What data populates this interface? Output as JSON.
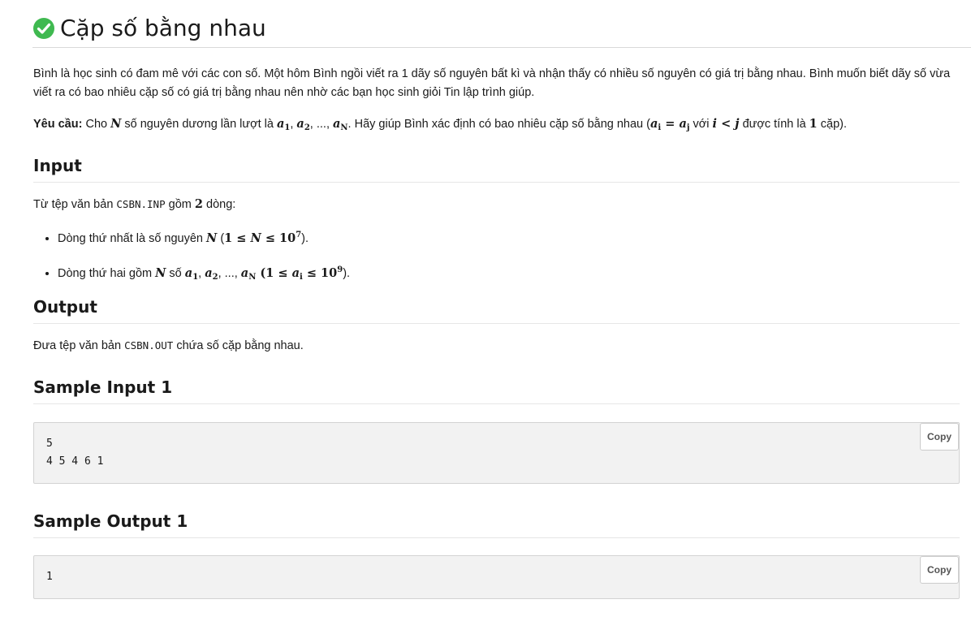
{
  "title": "Cặp số bằng nhau",
  "statement": {
    "p1": "Bình là học sinh có đam mê với các con số. Một hôm Bình ngồi viết ra 1 dãy số nguyên bất kì và nhận thấy có nhiều số nguyên có giá trị bằng nhau. Bình muốn biết dãy số vừa viết ra có bao nhiêu cặp số có giá trị bằng nhau nên nhờ các bạn học sinh giỏi Tin lập trình giúp.",
    "req_label": "Yêu cầu:",
    "req_t1": " Cho ",
    "req_t2": " số nguyên dương lần lượt là ",
    "req_t3": ". Hãy giúp Bình xác định có bao nhiêu cặp số bằng nhau (",
    "req_t4": " với ",
    "req_t5": " được tính là ",
    "req_t6": " cặp).",
    "N": "N",
    "a": "a",
    "sub1": "1",
    "sub2": "2",
    "subN": "N",
    "subi": "i",
    "subj": "j",
    "comma": ", ",
    "ellipsis": ", ..., ",
    "eq": " = ",
    "lt": " < ",
    "i": "i",
    "j": "j",
    "one": "1"
  },
  "input": {
    "heading": "Input",
    "desc_t1": "Từ tệp văn bản ",
    "file": "CSBN.INP",
    "desc_t2": " gồm ",
    "two": "2",
    "desc_t3": " dòng:",
    "li1_t1": "Dòng thứ nhất là số nguyên ",
    "li1_paren_open": " (",
    "li1_math1": "1 ≤ ",
    "li1_math2": " ≤ 10",
    "li1_exp": "7",
    "li1_close": ").",
    "li2_t1": "Dòng thứ hai gồm ",
    "li2_t2": " số ",
    "li2_math1": " (1 ≤ ",
    "li2_math2": " ≤ 10",
    "li2_exp": "9",
    "li2_close": ")."
  },
  "output": {
    "heading": "Output",
    "desc_t1": "Đưa tệp văn bản ",
    "file": "CSBN.OUT",
    "desc_t2": " chứa số cặp bằng nhau."
  },
  "sample_input": {
    "heading": "Sample Input 1",
    "code": "5\n4 5 4 6 1",
    "copy": "Copy"
  },
  "sample_output": {
    "heading": "Sample Output 1",
    "code": "1",
    "copy": "Copy"
  },
  "colors": {
    "check": "#3fb950"
  },
  "icons": {
    "status": "check-circle-icon"
  }
}
